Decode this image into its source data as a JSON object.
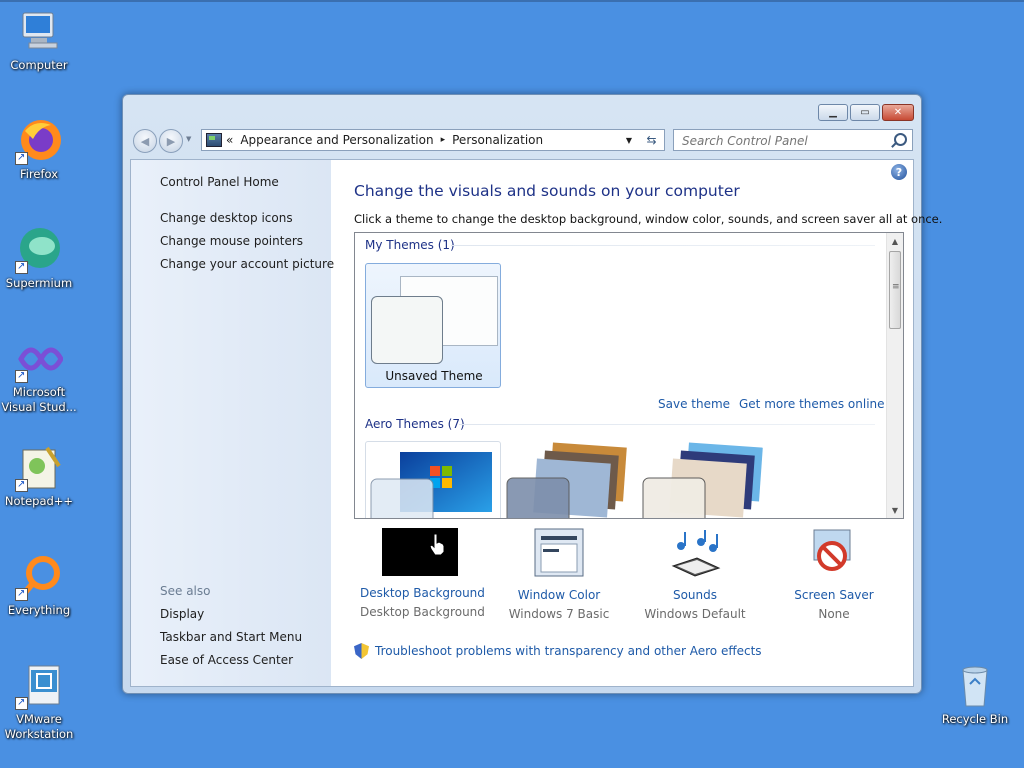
{
  "desktop": {
    "icons": [
      {
        "label": "Computer"
      },
      {
        "label": "Firefox"
      },
      {
        "label": "Supermium"
      },
      {
        "label": "Microsoft Visual Stud..."
      },
      {
        "label": "Notepad++"
      },
      {
        "label": "Everything"
      },
      {
        "label": "VMware Workstation"
      },
      {
        "label": "Recycle Bin"
      }
    ]
  },
  "window": {
    "caption_buttons": {
      "minimize": "minimize",
      "maximize": "maximize",
      "close": "close"
    },
    "breadcrumb": {
      "prefix": "«",
      "part1": "Appearance and Personalization",
      "separator": "▸",
      "part2": "Personalization"
    },
    "search_placeholder": "Search Control Panel",
    "left_pane": {
      "home": "Control Panel Home",
      "links": [
        "Change desktop icons",
        "Change mouse pointers",
        "Change your account picture"
      ],
      "see_also_header": "See also",
      "see_also": [
        "Display",
        "Taskbar and Start Menu",
        "Ease of Access Center"
      ]
    },
    "main": {
      "title": "Change the visuals and sounds on your computer",
      "subtitle": "Click a theme to change the desktop background, window color, sounds, and screen saver all at once.",
      "my_themes_header": "My Themes (1)",
      "unsaved_theme": "Unsaved Theme",
      "save_theme": "Save theme",
      "get_more_themes": "Get more themes online",
      "aero_themes_header": "Aero Themes (7)",
      "bottom": [
        {
          "title": "Desktop Background",
          "value": "Desktop Background"
        },
        {
          "title": "Window Color",
          "value": "Windows 7 Basic"
        },
        {
          "title": "Sounds",
          "value": "Windows Default"
        },
        {
          "title": "Screen Saver",
          "value": "None"
        }
      ],
      "troubleshoot": "Troubleshoot problems with transparency and other Aero effects"
    }
  },
  "colors": {
    "desktop": "#4a90e2",
    "link": "#1e5aa8",
    "heading": "#1e3287"
  }
}
